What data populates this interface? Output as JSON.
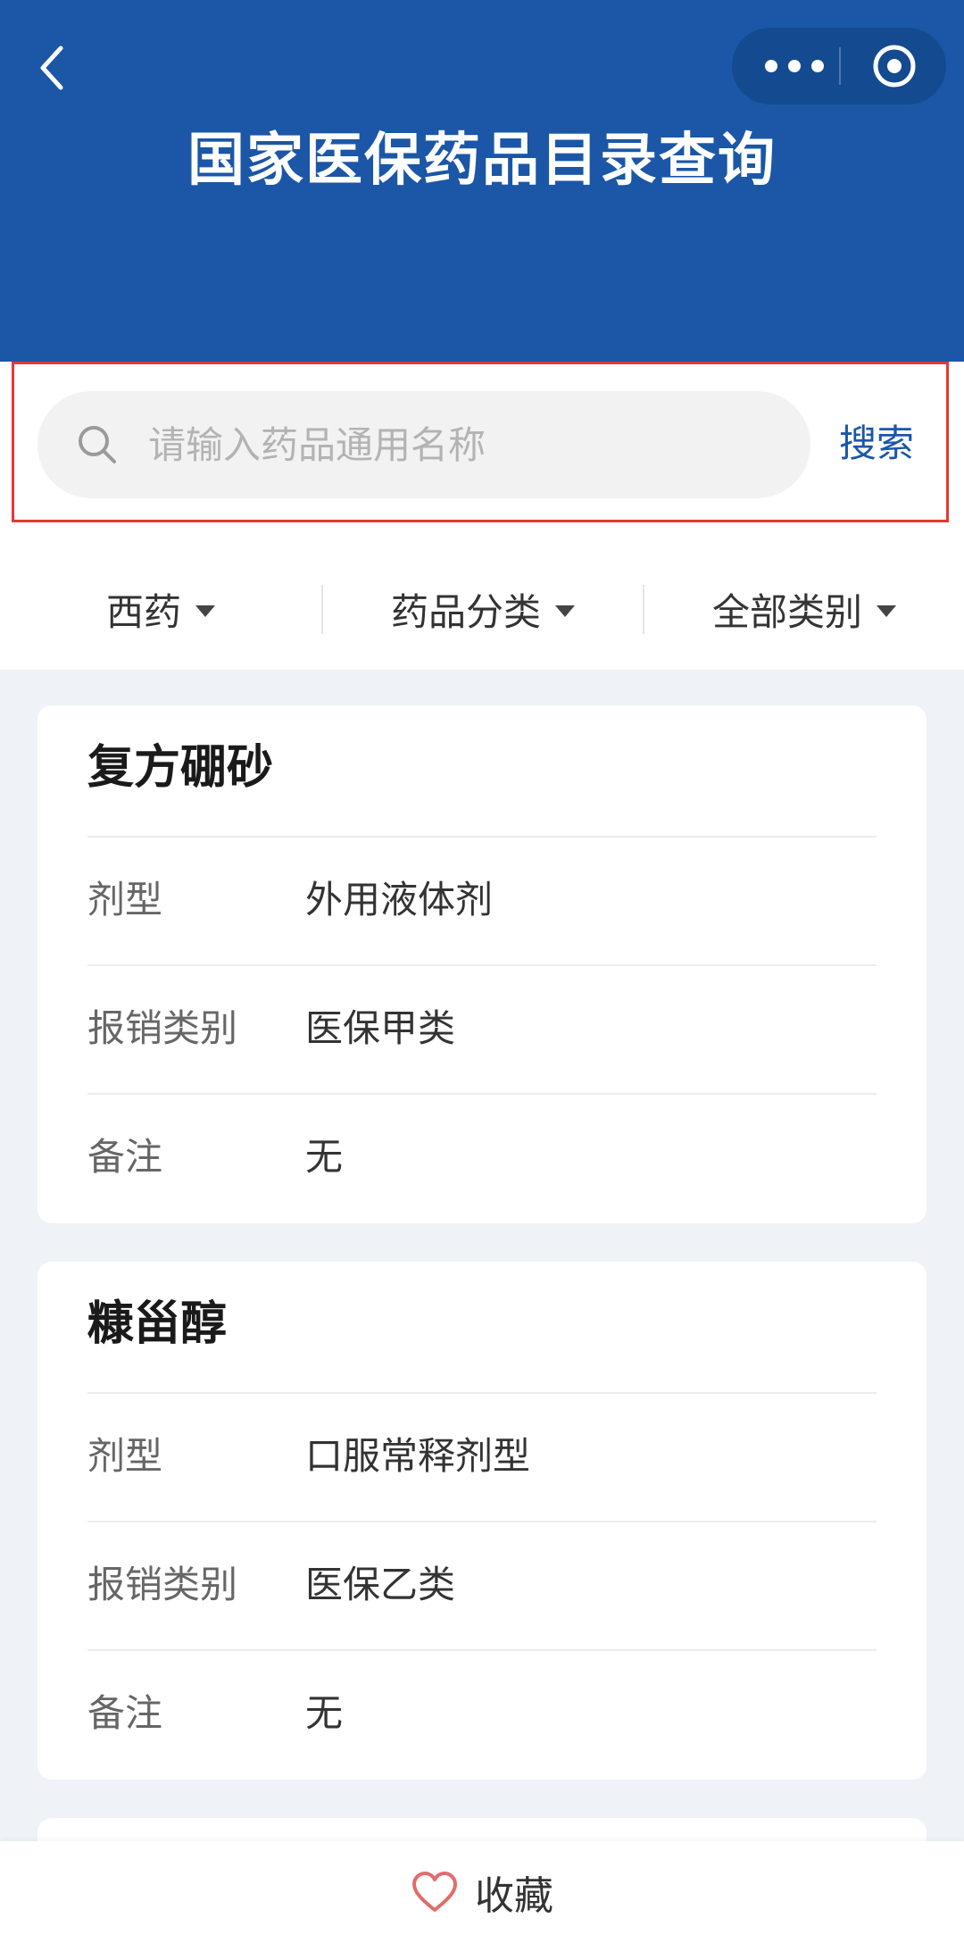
{
  "header": {
    "title": "国家医保药品目录查询",
    "background_color": "#1b57a6",
    "back_icon": "chevron-left-icon",
    "capsule_more_icon": "more-dots-icon",
    "capsule_close_icon": "target-icon"
  },
  "search": {
    "placeholder": "请输入药品通用名称",
    "value": "",
    "button_label": "搜索",
    "icon": "search-icon",
    "highlight_color": "#e53935"
  },
  "filters": [
    {
      "label": "西药"
    },
    {
      "label": "药品分类"
    },
    {
      "label": "全部类别"
    }
  ],
  "drugs": [
    {
      "name": "复方硼砂",
      "rows": [
        {
          "label": "剂型",
          "value": "外用液体剂"
        },
        {
          "label": "报销类别",
          "value": "医保甲类"
        },
        {
          "label": "备注",
          "value": "无"
        }
      ]
    },
    {
      "name": "糠甾醇",
      "rows": [
        {
          "label": "剂型",
          "value": "口服常释剂型"
        },
        {
          "label": "报销类别",
          "value": "医保乙类"
        },
        {
          "label": "备注",
          "value": "无"
        }
      ]
    }
  ],
  "bottom_bar": {
    "favorite_label": "收藏",
    "favorite_icon": "heart-icon",
    "favorite_color": "#e06c6c"
  }
}
